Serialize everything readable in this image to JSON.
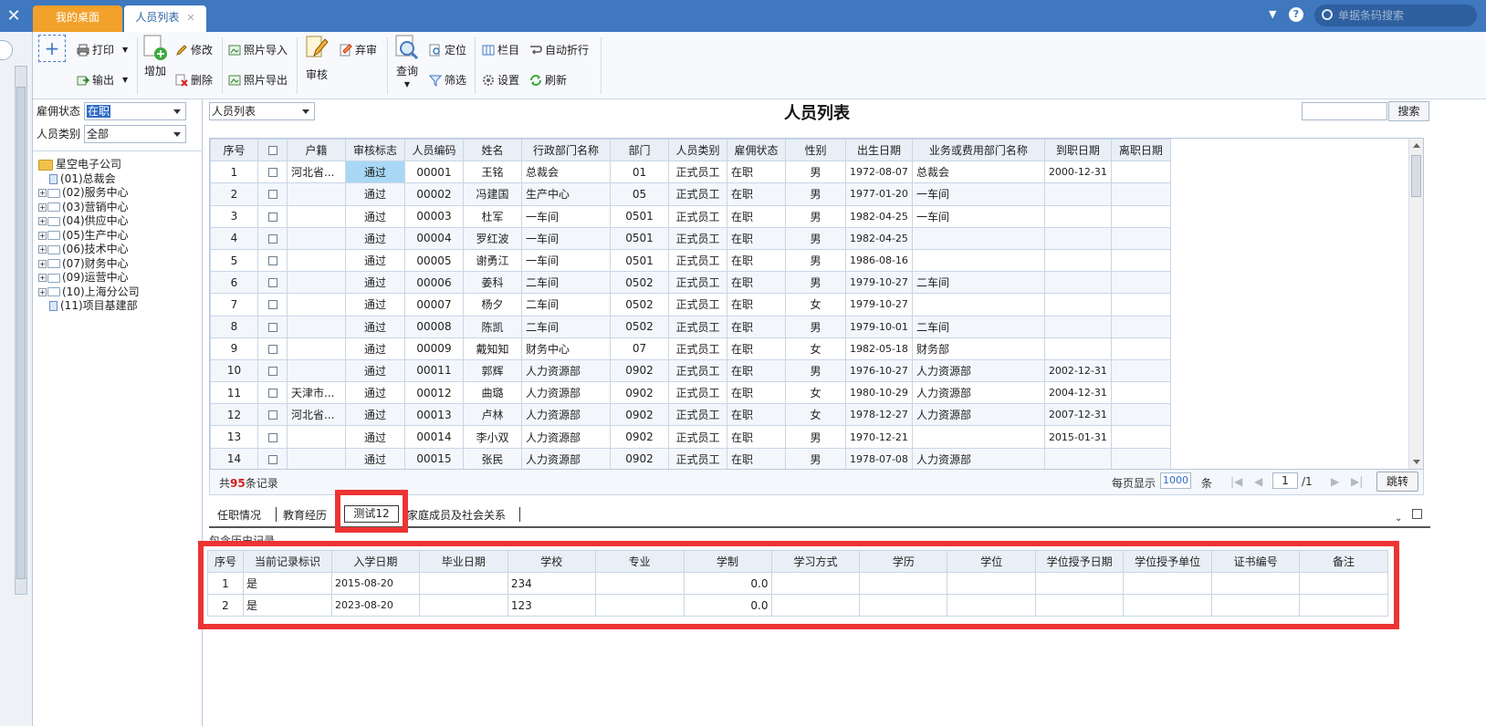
{
  "window": {
    "close_glyph": "✕",
    "tabs": [
      {
        "label": "我的桌面",
        "close": ""
      },
      {
        "label": "人员列表",
        "close": "✕"
      }
    ],
    "top_search_placeholder": "单据条码搜索"
  },
  "toolbar": {
    "add_glyph": "+",
    "print": "打印",
    "export": "输出",
    "add": "增加",
    "edit": "修改",
    "delete": "删除",
    "photo_import": "照片导入",
    "photo_export": "照片导出",
    "audit": "审核",
    "unaudit": "弃审",
    "query": "查询",
    "locate": "定位",
    "filter": "筛选",
    "columns": "栏目",
    "wrap": "自动折行",
    "settings": "设置",
    "refresh": "刷新"
  },
  "filters": {
    "employment_label": "雇佣状态",
    "employment_value": "在职",
    "category_label": "人员类别",
    "category_value": "全部"
  },
  "tree": {
    "root": "星空电子公司",
    "items": [
      {
        "label": "(01)总裁会",
        "expandable": false
      },
      {
        "label": "(02)服务中心",
        "expandable": true
      },
      {
        "label": "(03)营销中心",
        "expandable": true
      },
      {
        "label": "(04)供应中心",
        "expandable": true
      },
      {
        "label": "(05)生产中心",
        "expandable": true
      },
      {
        "label": "(06)技术中心",
        "expandable": true
      },
      {
        "label": "(07)财务中心",
        "expandable": true
      },
      {
        "label": "(09)运营中心",
        "expandable": true
      },
      {
        "label": "(10)上海分公司",
        "expandable": true
      },
      {
        "label": "(11)项目基建部",
        "expandable": false
      }
    ]
  },
  "main": {
    "list_select": "人员列表",
    "title": "人员列表",
    "search_button": "搜索"
  },
  "grid": {
    "columns": [
      "序号",
      "",
      "户籍",
      "审核标志",
      "人员编码",
      "姓名",
      "行政部门名称",
      "部门",
      "人员类别",
      "雇佣状态",
      "性别",
      "出生日期",
      "业务或费用部门名称",
      "到职日期",
      "离职日期"
    ],
    "rows": [
      [
        "1",
        "",
        "河北省...",
        "通过",
        "00001",
        "王铭",
        "总裁会",
        "01",
        "正式员工",
        "在职",
        "男",
        "1972-08-07",
        "总裁会",
        "2000-12-31",
        ""
      ],
      [
        "2",
        "",
        "",
        "通过",
        "00002",
        "冯建国",
        "生产中心",
        "05",
        "正式员工",
        "在职",
        "男",
        "1977-01-20",
        "一车间",
        "",
        ""
      ],
      [
        "3",
        "",
        "",
        "通过",
        "00003",
        "杜军",
        "一车间",
        "0501",
        "正式员工",
        "在职",
        "男",
        "1982-04-25",
        "一车间",
        "",
        ""
      ],
      [
        "4",
        "",
        "",
        "通过",
        "00004",
        "罗红波",
        "一车间",
        "0501",
        "正式员工",
        "在职",
        "男",
        "1982-04-25",
        "",
        "",
        ""
      ],
      [
        "5",
        "",
        "",
        "通过",
        "00005",
        "谢勇江",
        "一车间",
        "0501",
        "正式员工",
        "在职",
        "男",
        "1986-08-16",
        "",
        "",
        ""
      ],
      [
        "6",
        "",
        "",
        "通过",
        "00006",
        "姜科",
        "二车间",
        "0502",
        "正式员工",
        "在职",
        "男",
        "1979-10-27",
        "二车间",
        "",
        ""
      ],
      [
        "7",
        "",
        "",
        "通过",
        "00007",
        "杨夕",
        "二车间",
        "0502",
        "正式员工",
        "在职",
        "女",
        "1979-10-27",
        "",
        "",
        ""
      ],
      [
        "8",
        "",
        "",
        "通过",
        "00008",
        "陈凯",
        "二车间",
        "0502",
        "正式员工",
        "在职",
        "男",
        "1979-10-01",
        "二车间",
        "",
        ""
      ],
      [
        "9",
        "",
        "",
        "通过",
        "00009",
        "戴知知",
        "财务中心",
        "07",
        "正式员工",
        "在职",
        "女",
        "1982-05-18",
        "财务部",
        "",
        ""
      ],
      [
        "10",
        "",
        "",
        "通过",
        "00011",
        "郭辉",
        "人力资源部",
        "0902",
        "正式员工",
        "在职",
        "男",
        "1976-10-27",
        "人力资源部",
        "2002-12-31",
        ""
      ],
      [
        "11",
        "",
        "天津市...",
        "通过",
        "00012",
        "曲璐",
        "人力资源部",
        "0902",
        "正式员工",
        "在职",
        "女",
        "1980-10-29",
        "人力资源部",
        "2004-12-31",
        ""
      ],
      [
        "12",
        "",
        "河北省...",
        "通过",
        "00013",
        "卢林",
        "人力资源部",
        "0902",
        "正式员工",
        "在职",
        "女",
        "1978-12-27",
        "人力资源部",
        "2007-12-31",
        ""
      ],
      [
        "13",
        "",
        "",
        "通过",
        "00014",
        "李小双",
        "人力资源部",
        "0902",
        "正式员工",
        "在职",
        "男",
        "1970-12-21",
        "",
        "2015-01-31",
        ""
      ],
      [
        "14",
        "",
        "",
        "通过",
        "00015",
        "张民",
        "人力资源部",
        "0902",
        "正式员工",
        "在职",
        "男",
        "1978-07-08",
        "人力资源部",
        "",
        ""
      ]
    ]
  },
  "pager": {
    "total_prefix": "共",
    "total_count": "95",
    "total_suffix": "条记录",
    "page_size_label": "每页显示",
    "page_size": "1000",
    "page_size_unit": "条",
    "first": "|◀",
    "prev": "◀",
    "page": "1",
    "page_total": "/1",
    "next": "▶",
    "last": "▶|",
    "jump": "跳转"
  },
  "subtabs": {
    "items": [
      "任职情况",
      "教育经历",
      "测试12",
      "家庭成员及社会关系"
    ],
    "collapse_glyph": "⌄",
    "history_label": "包含历史记录"
  },
  "subgrid": {
    "columns": [
      "序号",
      "当前记录标识",
      "入学日期",
      "毕业日期",
      "学校",
      "专业",
      "学制",
      "学习方式",
      "学历",
      "学位",
      "学位授予日期",
      "学位授予单位",
      "证书编号",
      "备注"
    ],
    "rows": [
      [
        "1",
        "是",
        "2015-08-20",
        "",
        "234",
        "",
        "0.0",
        "",
        "",
        "",
        "",
        "",
        "",
        ""
      ],
      [
        "2",
        "是",
        "2023-08-20",
        "",
        "123",
        "",
        "0.0",
        "",
        "",
        "",
        "",
        "",
        "",
        ""
      ]
    ]
  },
  "colors": {
    "topbar": "#3f78bf",
    "active_desk_tab": "#f2a12a",
    "highlight_red": "#ee3333",
    "pass_cell": "#a8d8f5"
  }
}
